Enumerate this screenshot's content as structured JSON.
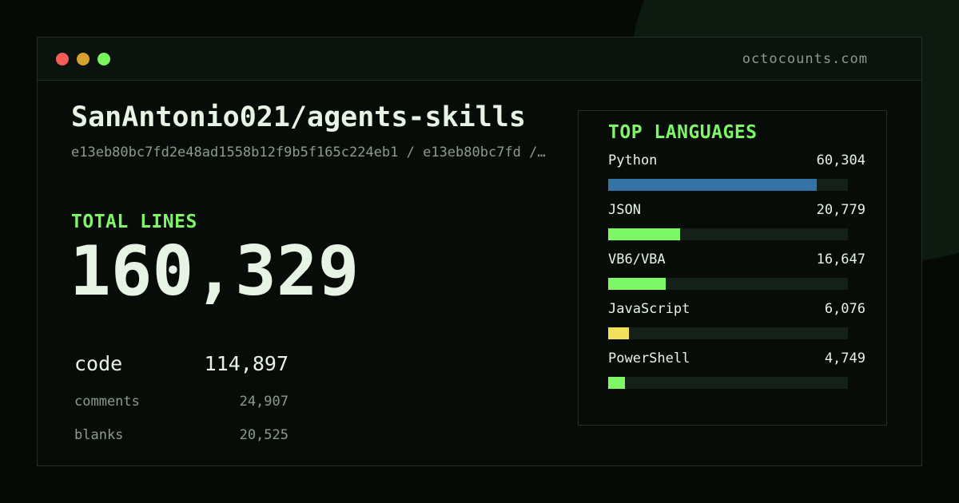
{
  "window": {
    "domain": "octocounts.com"
  },
  "repo": {
    "title": "SanAntonio021/agents-skills",
    "commit_line": "e13eb80bc7fd2e48ad1558b12f9b5f165c224eb1 / e13eb80bc7fd /…"
  },
  "totals": {
    "label": "TOTAL LINES",
    "value": "160,329",
    "breakdown": [
      {
        "label": "code",
        "value": "114,897"
      },
      {
        "label": "comments",
        "value": "24,907"
      },
      {
        "label": "blanks",
        "value": "20,525"
      }
    ]
  },
  "languages_panel": {
    "title": "TOP LANGUAGES",
    "items": [
      {
        "name": "Python",
        "count": "60,304",
        "lines": 60304,
        "color": "#3572A5"
      },
      {
        "name": "JSON",
        "count": "20,779",
        "lines": 20779,
        "color": "#7df765"
      },
      {
        "name": "VB6/VBA",
        "count": "16,647",
        "lines": 16647,
        "color": "#7df765"
      },
      {
        "name": "JavaScript",
        "count": "6,076",
        "lines": 6076,
        "color": "#f1e05a"
      },
      {
        "name": "PowerShell",
        "count": "4,749",
        "lines": 4749,
        "color": "#7df765"
      }
    ]
  },
  "colors": {
    "accent_green": "#7df765",
    "text_primary": "#e7f3e4",
    "text_muted": "#8c9a90",
    "background": "#060a07",
    "border": "#223025",
    "traffic_red": "#f35d55",
    "traffic_yellow": "#d6a12f",
    "traffic_green": "#7bf55f"
  }
}
